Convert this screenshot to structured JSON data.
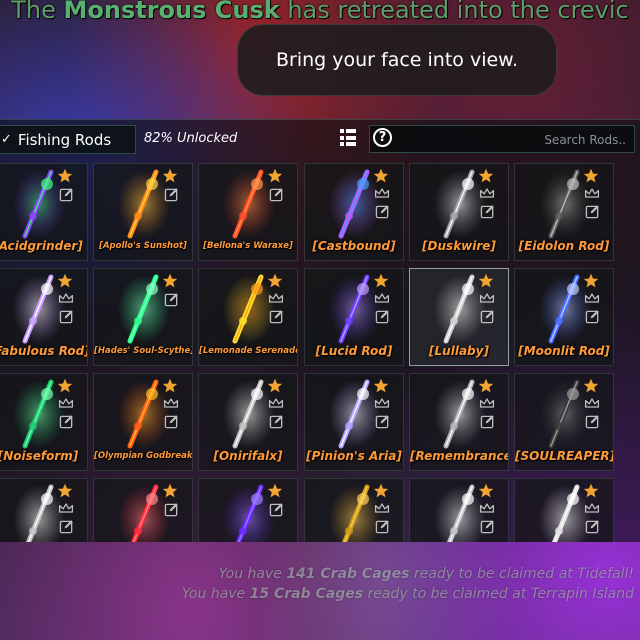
{
  "top_message": {
    "prefix": "The ",
    "creature": "Monstrous Cusk",
    "suffix": " has retreated into the crevic"
  },
  "toast": {
    "text": "Bring your face into view."
  },
  "toolbar": {
    "title": "Fishing Rods",
    "unlocked": "82% Unlocked",
    "search_placeholder": "Search Rods.."
  },
  "rods": [
    {
      "name": "[Acidgrinder]",
      "color": "#8a3cff",
      "glow": "#3cff7a",
      "crown": false
    },
    {
      "name": "[Apollo's Sunshot]",
      "color": "#ff8a1a",
      "glow": "#ffd54a",
      "crown": false,
      "small": true
    },
    {
      "name": "[Bellona's Waraxe]",
      "color": "#ff4a2a",
      "glow": "#ff9a4a",
      "crown": false,
      "small": true
    },
    {
      "name": "[Castbound]",
      "color": "#b25cff",
      "glow": "#4aa0ff",
      "crown": true
    },
    {
      "name": "[Duskwire]",
      "color": "#9aa0a6",
      "glow": "#ffffff",
      "crown": true
    },
    {
      "name": "[Eidolon Rod]",
      "color": "#5a5a5a",
      "glow": "#c0c0c0",
      "crown": true
    },
    {
      "name": "[Fabulous Rod]",
      "color": "#c89cff",
      "glow": "#ffffff",
      "crown": true
    },
    {
      "name": "[Hades' Soul-Scythe]",
      "color": "#2aff8a",
      "glow": "#8affc8",
      "crown": false,
      "small": true
    },
    {
      "name": "[Lemonade Serenade]",
      "color": "#ffe02a",
      "glow": "#ff9a1a",
      "crown": true,
      "small": true
    },
    {
      "name": "[Lucid Rod]",
      "color": "#6a3cff",
      "glow": "#c0a0ff",
      "crown": true
    },
    {
      "name": "[Lullaby]",
      "color": "#d0d0d0",
      "glow": "#ffffff",
      "crown": true
    },
    {
      "name": "[Moonlit Rod]",
      "color": "#4a6aff",
      "glow": "#c0d0ff",
      "crown": true
    },
    {
      "name": "[Noiseform]",
      "color": "#1ac870",
      "glow": "#7affb0",
      "crown": true
    },
    {
      "name": "[Olympian Godbreaker]",
      "color": "#ff5a1a",
      "glow": "#ffc02a",
      "crown": true,
      "small": true
    },
    {
      "name": "[Onirifalx]",
      "color": "#c0c0c0",
      "glow": "#ffffff",
      "crown": true
    },
    {
      "name": "[Pinion's Aria]",
      "color": "#b0a0ff",
      "glow": "#ffffff",
      "crown": true
    },
    {
      "name": "[Remembrance]",
      "color": "#b0b0b0",
      "glow": "#ffffff",
      "crown": true
    },
    {
      "name": "[SOULREAPER]",
      "color": "#3a3a3a",
      "glow": "#a0a0a0",
      "crown": true
    },
    {
      "name": "",
      "color": "#c0c0c0",
      "glow": "#ffffff",
      "crown": true
    },
    {
      "name": "",
      "color": "#ff2a3a",
      "glow": "#ff8a8a",
      "crown": false
    },
    {
      "name": "",
      "color": "#6a2aff",
      "glow": "#a080ff",
      "crown": false
    },
    {
      "name": "",
      "color": "#d09a1a",
      "glow": "#ffd060",
      "crown": true
    },
    {
      "name": "",
      "color": "#c0c0c0",
      "glow": "#ffffff",
      "crown": true
    },
    {
      "name": "",
      "color": "#e0e0e0",
      "glow": "#ffffff",
      "crown": true
    }
  ],
  "notices": [
    {
      "prefix": "You have ",
      "count": "141 Crab Cages",
      "suffix": " ready to be claimed at Tidefall!"
    },
    {
      "prefix": "You have ",
      "count": "15 Crab Cages",
      "suffix": " ready to be claimed at Terrapin Island"
    }
  ],
  "colors": {
    "accent_star": "#f2a531",
    "rod_name": "#ff9a3a",
    "cusk": "#58b070"
  },
  "icons": [
    "star-icon",
    "crown-icon",
    "edit-icon",
    "grid-view-icon",
    "help-icon",
    "chevron-icon"
  ]
}
